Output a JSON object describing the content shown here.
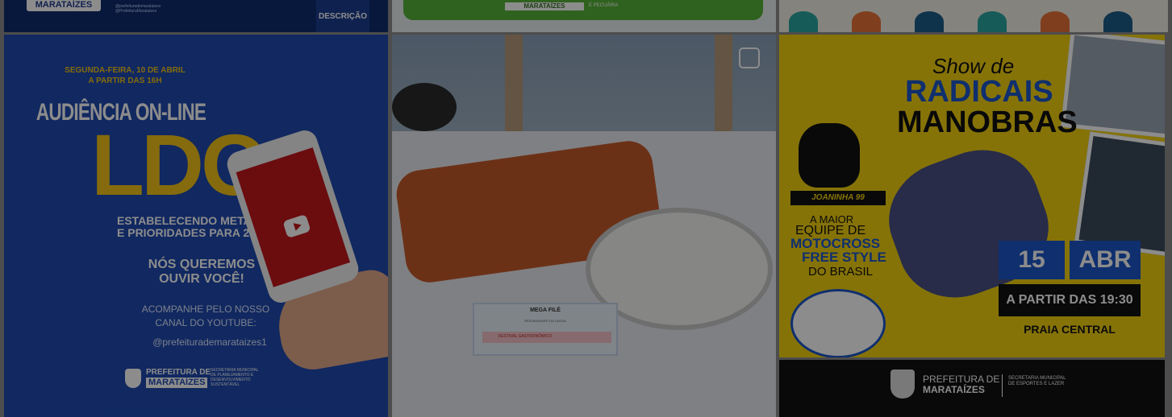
{
  "strip1": {
    "logo": "MARATAÍZES",
    "social": [
      "@prefeiturademarataizes",
      "@PrefeituraMarataizes"
    ],
    "desc_button": "DESCRIÇÃO"
  },
  "strip2": {
    "logo": "MARATAÍZES",
    "sub": "E PECUÁRIA"
  },
  "post1": {
    "date_line1": "SEGUNDA-FEIRA, 10 DE ABRIL",
    "date_line2": "A PARTIR DAS 16H",
    "title": "AUDIÊNCIA ON-LINE",
    "big": "LDO",
    "metas_line1": "ESTABELECENDO METAS",
    "metas_line2": "E PRIORIDADES PARA 2024",
    "queremos_line1": "NÓS QUEREMOS",
    "queremos_line2": "OUVIR VOCÊ!",
    "acompanhe_line1": "ACOMPANHE PELO NOSSO",
    "acompanhe_line2": "CANAL DO YOUTUBE:",
    "handle": "@prefeiturademarataizes1",
    "pref_line1": "PREFEITURA DE",
    "pref_line2": "MARATAÍZES",
    "secretaria": "SECRETARIA MUNICIPAL DE PLANEJAMENTO E DESENVOLVIMENTO SUSTENTÁVEL"
  },
  "post2": {
    "card_title": "MEGA FILÉ",
    "card_sub": "RESTAURANTE DO LAGOA",
    "card_banner": "FESTIVAL GASTRONÔMICO"
  },
  "post3": {
    "show": "Show de",
    "radicais": "RADICAIS",
    "manobras": "MANOBRAS",
    "team": "JOANINHA 99",
    "line_a": "A MAIOR",
    "line_b": "EQUIPE DE",
    "line_c": "MOTOCROSS",
    "line_d": "FREE STYLE",
    "line_e": "DO BRASIL",
    "day": "15",
    "month": "ABR",
    "time": "A PARTIR DAS 19:30",
    "place": "PRAIA CENTRAL",
    "pref_line1": "PREFEITURA DE",
    "pref_line2": "MARATAÍZES",
    "secretaria": "SECRETARIA MUNICIPAL DE ESPORTES E LAZER"
  },
  "colors": {
    "blue": "#1f4ab0",
    "yellow": "#f2c318",
    "moto_blue": "#1d56c9",
    "green": "#58b23a"
  }
}
